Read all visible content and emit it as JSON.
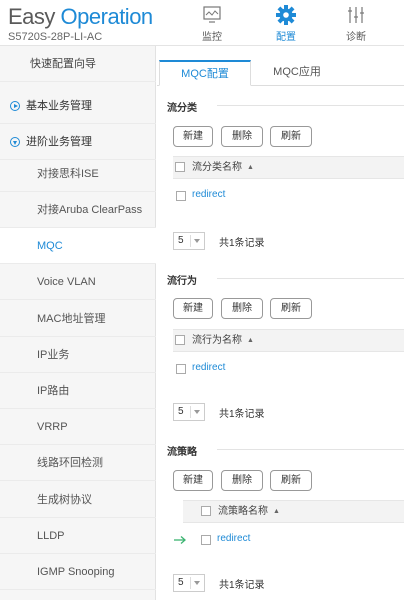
{
  "header": {
    "logo_part1": "Easy",
    "logo_part2": "Operation",
    "model": "S5720S-28P-LI-AC",
    "nav": [
      {
        "label": "监控",
        "icon": "monitor-icon"
      },
      {
        "label": "配置",
        "icon": "gear-icon",
        "active": true
      },
      {
        "label": "诊断",
        "icon": "sliders-icon"
      }
    ]
  },
  "sidebar": {
    "items": [
      {
        "label": "快速配置向导"
      },
      {
        "label": "基本业务管理"
      },
      {
        "label": "进阶业务管理"
      },
      {
        "label": "对接思科ISE"
      },
      {
        "label": "对接Aruba ClearPass"
      },
      {
        "label": "MQC"
      },
      {
        "label": "Voice VLAN"
      },
      {
        "label": "MAC地址管理"
      },
      {
        "label": "IP业务"
      },
      {
        "label": "IP路由"
      },
      {
        "label": "VRRP"
      },
      {
        "label": "线路环回检测"
      },
      {
        "label": "生成树协议"
      },
      {
        "label": "LLDP"
      },
      {
        "label": "IGMP Snooping"
      }
    ]
  },
  "tabs": [
    {
      "label": "MQC配置"
    },
    {
      "label": "MQC应用"
    }
  ],
  "sections": [
    {
      "title": "流分类",
      "buttons": [
        "新建",
        "删除",
        "刷新"
      ],
      "column": "流分类名称",
      "row": "redirect",
      "page_size": "5",
      "records": "共1条记录"
    },
    {
      "title": "流行为",
      "buttons": [
        "新建",
        "删除",
        "刷新"
      ],
      "column": "流行为名称",
      "row": "redirect",
      "page_size": "5",
      "records": "共1条记录"
    },
    {
      "title": "流策略",
      "buttons": [
        "新建",
        "删除",
        "刷新"
      ],
      "column": "流策略名称",
      "row": "redirect",
      "page_size": "5",
      "records": "共1条记录"
    }
  ],
  "colors": {
    "accent": "#1e8ad6",
    "arrow": "#3cb371"
  }
}
